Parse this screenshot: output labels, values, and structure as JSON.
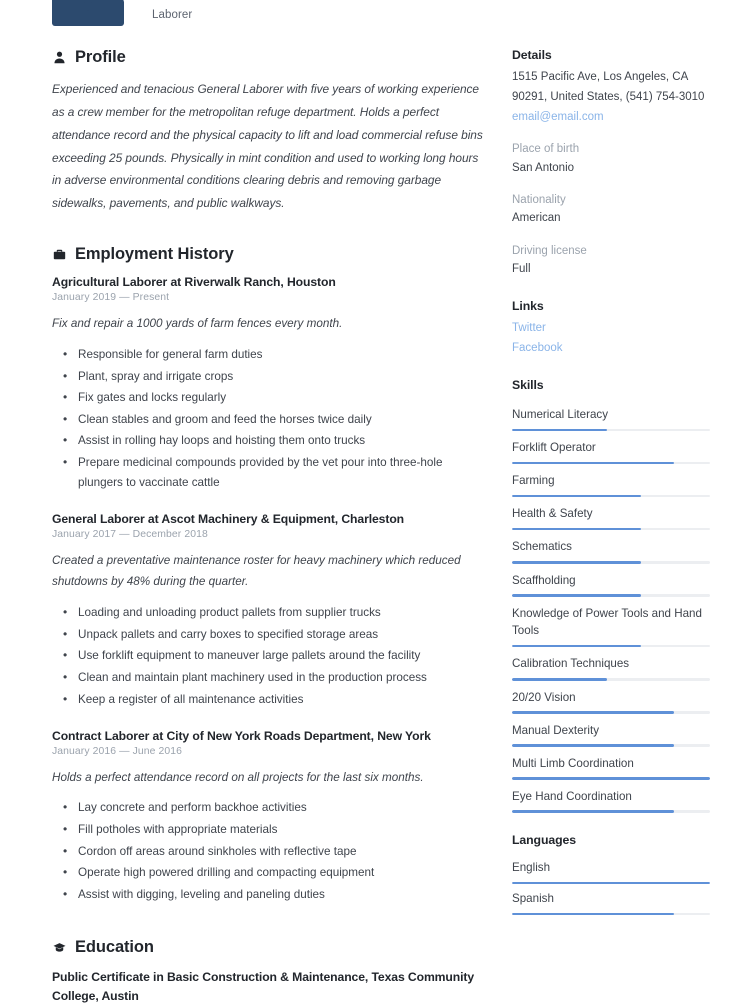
{
  "header": {
    "role": "Laborer",
    "avatar_icon": "person-photo"
  },
  "colors": {
    "accent": "#5f91d8",
    "link": "#8ab4e8",
    "heading": "#22262c",
    "body": "#3f444c",
    "muted": "#9ba3ad",
    "track": "#eceef1"
  },
  "main": {
    "profile": {
      "icon": "person-icon",
      "title": "Profile",
      "text": "Experienced and tenacious General Laborer with five years of working experience as a crew member for the metropolitan refuge department. Holds a perfect attendance record and the physical capacity to lift and load commercial refuse bins exceeding 25 pounds. Physically in mint condition and used to working long hours in adverse environmental conditions clearing debris and removing garbage sidewalks, pavements, and public walkways."
    },
    "employment": {
      "icon": "briefcase-icon",
      "title": "Employment History",
      "jobs": [
        {
          "title": "Agricultural Laborer at  Riverwalk Ranch, Houston",
          "date": "January 2019 — Present",
          "summary": "Fix and repair a 1000 yards of farm fences every month.",
          "bullets": [
            "Responsible for general farm duties",
            "Plant, spray and irrigate crops",
            "Fix gates and locks regularly",
            "Clean stables and groom and feed the horses twice daily",
            "Assist in rolling hay loops and hoisting them onto trucks",
            "Prepare  medicinal compounds provided by the vet pour into three-hole plungers to    vaccinate cattle"
          ]
        },
        {
          "title": "General Laborer at  Ascot Machinery & Equipment, Charleston",
          "date": "January 2017 — December 2018",
          "summary": "Created a preventative maintenance roster for heavy machinery which reduced shutdowns by 48% during the quarter.",
          "bullets": [
            "Loading and unloading product pallets from supplier trucks",
            "Unpack pallets  and carry boxes to specified storage areas",
            "Use forklift equipment to maneuver large pallets around the facility",
            "Clean and maintain plant machinery used in the production process",
            "Keep a register of all maintenance activities"
          ]
        },
        {
          "title": "Contract Laborer at  City of New York Roads Department, New York",
          "date": "January 2016 — June 2016",
          "summary": "Holds a perfect attendance record on all projects for the last six months.",
          "bullets": [
            "Lay concrete and perform backhoe activities",
            "Fill potholes with appropriate materials",
            "Cordon off areas around sinkholes with reflective tape",
            "Operate high powered drilling and compacting equipment",
            "Assist with digging, leveling and paneling duties"
          ]
        }
      ]
    },
    "education": {
      "icon": "graduation-cap-icon",
      "title": "Education",
      "entries": [
        {
          "title": "Public Certificate in Basic Construction & Maintenance, Texas Community College, Austin"
        }
      ]
    }
  },
  "sidebar": {
    "details": {
      "title": "Details",
      "address": "1515 Pacific Ave, Los Angeles, CA 90291, United States, (541) 754-3010",
      "email": "email@email.com",
      "fields": [
        {
          "label": "Place of birth",
          "value": "San Antonio"
        },
        {
          "label": "Nationality",
          "value": "American"
        },
        {
          "label": "Driving license",
          "value": "Full"
        }
      ]
    },
    "links": {
      "title": "Links",
      "items": [
        {
          "label": "Twitter"
        },
        {
          "label": "Facebook"
        }
      ]
    },
    "skills": {
      "title": "Skills",
      "items": [
        {
          "name": "Numerical Literacy",
          "level": 48
        },
        {
          "name": "Forklift Operator",
          "level": 82
        },
        {
          "name": "Farming",
          "level": 65
        },
        {
          "name": "Health & Safety",
          "level": 65
        },
        {
          "name": "Schematics",
          "level": 65
        },
        {
          "name": "Scaffholding",
          "level": 65
        },
        {
          "name": "Knowledge of Power Tools and Hand Tools",
          "level": 65
        },
        {
          "name": "Calibration Techniques",
          "level": 48
        },
        {
          "name": "20/20 Vision",
          "level": 82
        },
        {
          "name": "Manual Dexterity",
          "level": 82
        },
        {
          "name": "Multi Limb Coordination",
          "level": 100
        },
        {
          "name": "Eye Hand Coordination",
          "level": 82
        }
      ]
    },
    "languages": {
      "title": "Languages",
      "items": [
        {
          "name": "English",
          "level": 100
        },
        {
          "name": "Spanish",
          "level": 82
        }
      ]
    }
  }
}
